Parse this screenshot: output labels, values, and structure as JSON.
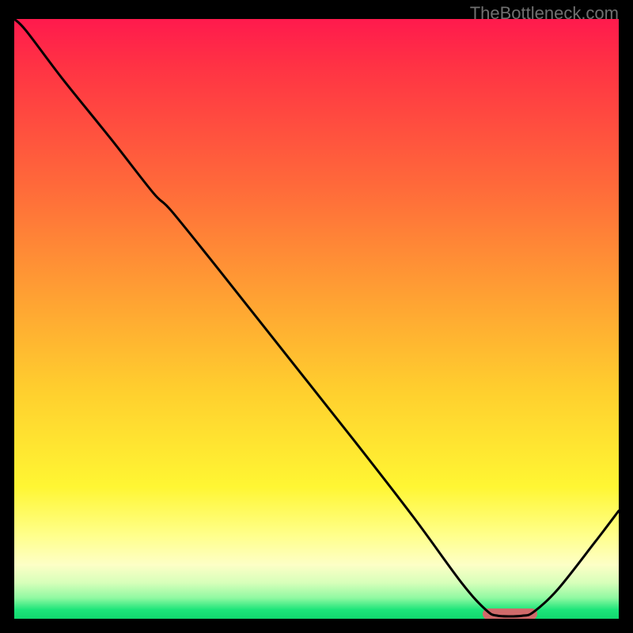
{
  "watermark": "TheBottleneck.com",
  "chart_data": {
    "type": "line",
    "title": "",
    "xlabel": "",
    "ylabel": "",
    "x": [
      0.0,
      0.02,
      0.08,
      0.16,
      0.23,
      0.26,
      0.34,
      0.45,
      0.56,
      0.66,
      0.74,
      0.78,
      0.8,
      0.84,
      0.86,
      0.9,
      0.96,
      1.0
    ],
    "values": [
      1.0,
      0.98,
      0.9,
      0.8,
      0.71,
      0.68,
      0.58,
      0.44,
      0.3,
      0.17,
      0.06,
      0.015,
      0.005,
      0.005,
      0.012,
      0.05,
      0.127,
      0.18
    ],
    "ylim": [
      0,
      1
    ],
    "xlim": [
      0,
      1
    ],
    "annotations": [],
    "optimal_marker": {
      "x0": 0.775,
      "x1": 0.865,
      "y": 0.0075
    },
    "gradient_stops": [
      {
        "pos": 0.0,
        "color": "#ff1a4d"
      },
      {
        "pos": 0.28,
        "color": "#ff6a3a"
      },
      {
        "pos": 0.62,
        "color": "#ffcf2e"
      },
      {
        "pos": 0.86,
        "color": "#ffff8a"
      },
      {
        "pos": 0.965,
        "color": "#91f9a2"
      },
      {
        "pos": 1.0,
        "color": "#11d86e"
      }
    ]
  }
}
